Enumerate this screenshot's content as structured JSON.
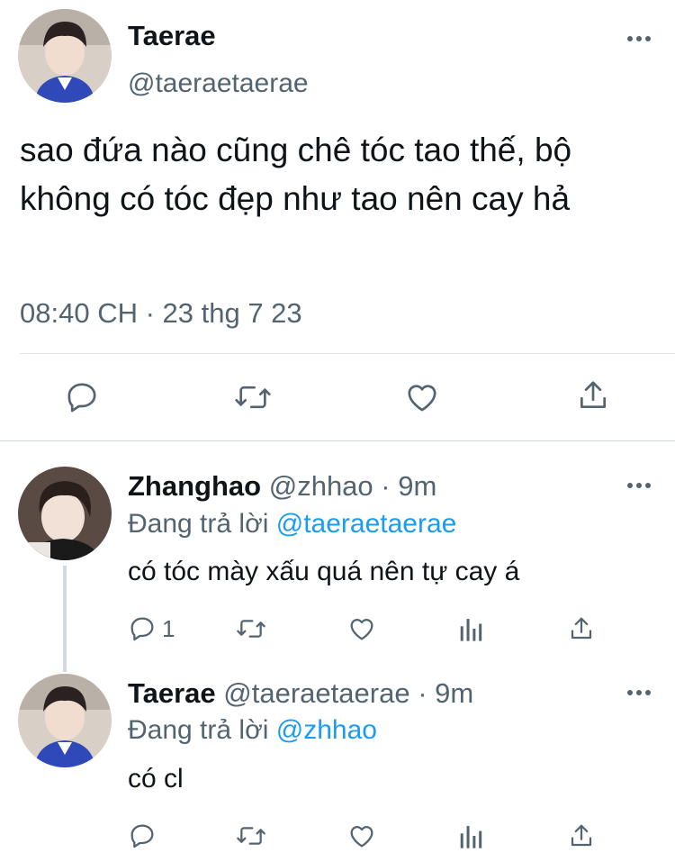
{
  "main_tweet": {
    "name": "Taerae",
    "handle": "@taeraetaerae",
    "text": "sao đứa nào cũng chê tóc tao thế, bộ không có tóc đẹp như tao nên cay hả",
    "timestamp": "08:40 CH · 23 thg 7 23",
    "actions": [
      "reply-icon",
      "retweet-icon",
      "like-icon",
      "share-icon"
    ]
  },
  "replies": [
    {
      "name": "Zhanghao",
      "handle": "@zhhao",
      "separator": "·",
      "time": "9m",
      "replying_prefix": "Đang trả lời",
      "replying_to": "@taeraetaerae",
      "text": "có tóc mày xấu quá nên tự cay á",
      "reply_count": "1",
      "actions": [
        "reply-icon",
        "retweet-icon",
        "like-icon",
        "views-icon",
        "share-icon"
      ]
    },
    {
      "name": "Taerae",
      "handle": "@taeraetaerae",
      "separator": "·",
      "time": "9m",
      "replying_prefix": "Đang trả lời",
      "replying_to": "@zhhao",
      "text": "có cl",
      "reply_count": "",
      "actions": [
        "reply-icon",
        "retweet-icon",
        "like-icon",
        "views-icon",
        "share-icon"
      ]
    }
  ],
  "colors": {
    "text": "#0f1419",
    "secondary": "#536471",
    "link": "#1d9bf0",
    "divider": "#cfd9de"
  }
}
